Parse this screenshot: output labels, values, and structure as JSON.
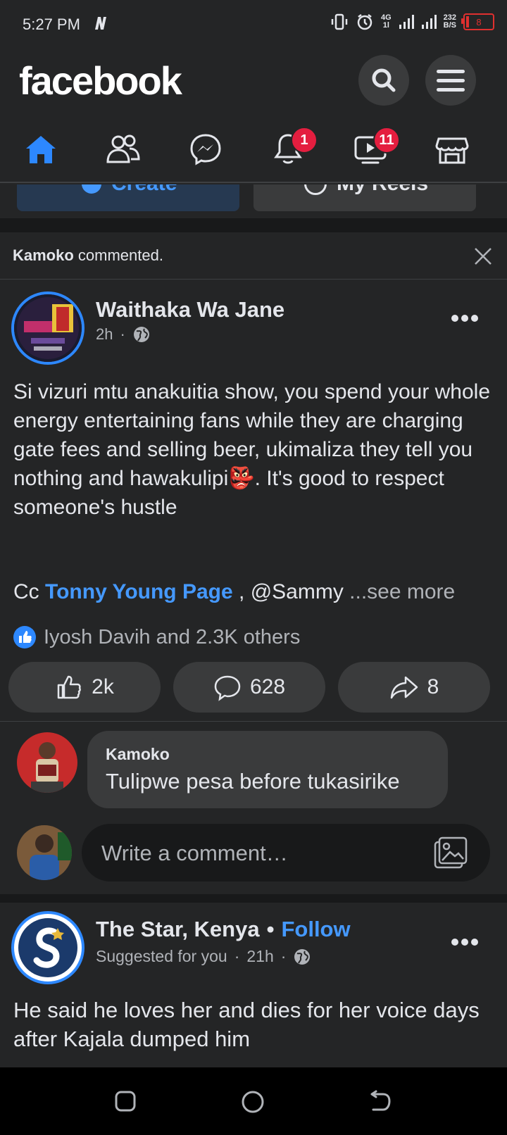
{
  "status_bar": {
    "time": "5:27 PM",
    "network_speed_value": "232",
    "network_speed_unit": "B/S",
    "network_type_top": "4G",
    "network_type_bottom": "1l",
    "battery_level": "8",
    "battery_color": "#e0302f"
  },
  "header": {
    "logo": "facebook",
    "search_icon": "search-icon",
    "menu_icon": "menu-icon"
  },
  "nav_tabs": [
    {
      "name": "home",
      "icon": "home-icon",
      "active": true,
      "badge": ""
    },
    {
      "name": "friends",
      "icon": "friends-icon",
      "active": false,
      "badge": ""
    },
    {
      "name": "messenger",
      "icon": "messenger-icon",
      "active": false,
      "badge": ""
    },
    {
      "name": "notifications",
      "icon": "bell-icon",
      "active": false,
      "badge": "1"
    },
    {
      "name": "watch",
      "icon": "video-icon",
      "active": false,
      "badge": "11"
    },
    {
      "name": "marketplace",
      "icon": "marketplace-icon",
      "active": false,
      "badge": ""
    }
  ],
  "peek_buttons": {
    "create": "Create",
    "my_reels": "My Reels"
  },
  "notice": {
    "name": "Kamoko",
    "action": " commented."
  },
  "post": {
    "author": "Waithaka Wa Jane",
    "time": "2h",
    "separator": "·",
    "body": "Si vizuri mtu anakuitia show, you spend your whole energy entertaining fans while they are charging gate fees and selling beer, ukimaliza they tell you nothing and hawakulipi",
    "emoji": "👺",
    "body_end": ". It's good to respect someone's hustle",
    "cc_prefix": "Cc ",
    "cc_tag": "Tonny Young Page",
    "cc_rest": " , @Sammy ",
    "see_more": "...see more",
    "reactions_text": "Iyosh Davih and 2.3K others",
    "like_count": "2k",
    "comment_count": "628",
    "share_count": "8"
  },
  "comment": {
    "author": "Kamoko",
    "text": "Tulipwe pesa before tukasirike"
  },
  "write_comment": {
    "placeholder": "Write a comment…"
  },
  "next_post": {
    "author": "The Star, Kenya",
    "bullet": "•",
    "follow": "Follow",
    "suggested": "Suggested for you",
    "time": "21h",
    "separator": "·",
    "body": "He said he loves her and dies for her voice days after Kajala dumped him"
  },
  "colors": {
    "background": "#242526",
    "divider": "#18191a",
    "surface": "#3a3b3c",
    "accent": "#2d88ff",
    "link": "#4599ff",
    "badge": "#e41e3f"
  }
}
